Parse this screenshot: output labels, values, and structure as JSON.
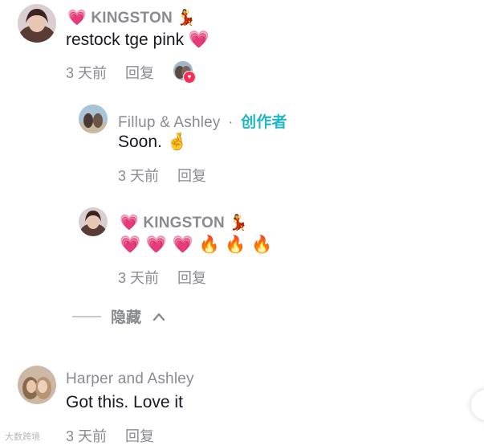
{
  "comments": [
    {
      "username_prefix": "💗",
      "username": "KINGSTON",
      "username_suffix": "💃",
      "text": "restock tge pink 💗",
      "time": "3 天前",
      "reply": "回复"
    },
    {
      "username": "Harper and Ashley",
      "text": "Got this. Love it",
      "time": "3 天前",
      "reply": "回复"
    }
  ],
  "replies": [
    {
      "username": "Fillup & Ashley",
      "separator": "·",
      "badge": "创作者",
      "text": "Soon. 🤞",
      "time": "3 天前",
      "reply": "回复"
    },
    {
      "username_prefix": "💗",
      "username": "KINGSTON",
      "username_suffix": "💃",
      "text": "💗 💗 💗 🔥 🔥 🔥",
      "time": "3 天前",
      "reply": "回复"
    }
  ],
  "hide_label": "隐藏",
  "watermark": "大数跨境",
  "colors": {
    "meta_gray": "#8a8b91",
    "text_dark": "#161823",
    "creator_teal": "#20b7c4",
    "like_red": "#fe2c55"
  },
  "icons": {
    "chevron": "chevron-up-icon",
    "liked_by_creator": "heart-icon"
  }
}
